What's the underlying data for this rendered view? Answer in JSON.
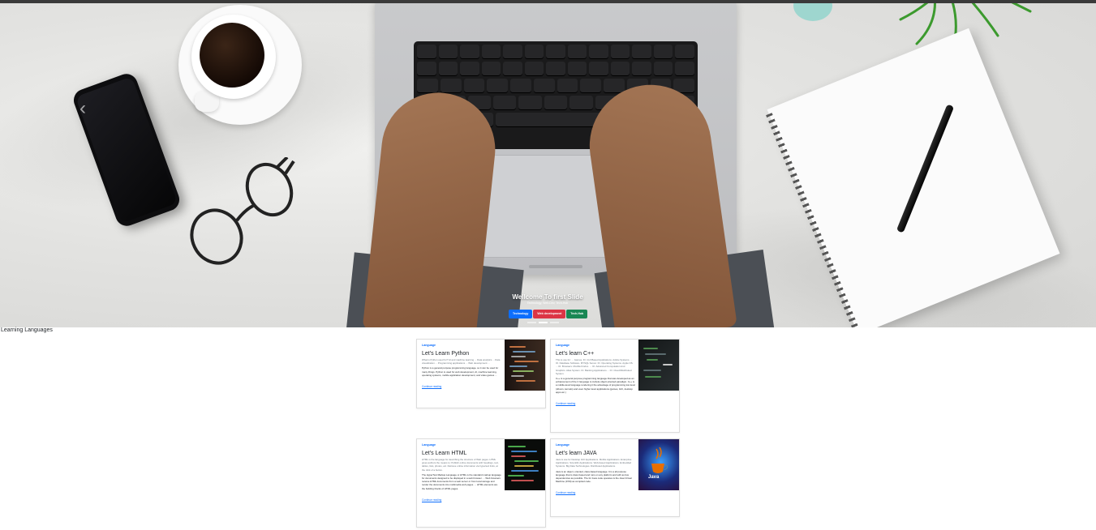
{
  "hero": {
    "title": "Wellcome To first Slide",
    "subtitle": "Technology, Web-Dev, Tech-Hub",
    "prev_glyph": "‹",
    "badges": [
      {
        "label": "Technology",
        "color": "#0d6efd"
      },
      {
        "label": "Web development",
        "color": "#dc3545"
      },
      {
        "label": "Tech-Hub",
        "color": "#198754"
      }
    ],
    "indicator_count": 3,
    "active_indicator": 1
  },
  "section": {
    "title": "Learning Languages"
  },
  "cards": [
    {
      "category": "Language",
      "title": "Let's Learn Python",
      "excerpt": "What is Python used for? AI and machine learning ... Data analytics ... Data visualization ... Programming applications ... Web development ...",
      "body": "Python is a general purpose programming language, so it can be used for many things. Python is used for web development, AI, machine learning, operating systems, mobile application development, and video games ...",
      "link": "Continue reading",
      "thumb": "python-code-image"
    },
    {
      "category": "Language",
      "title": "Let's learn C++",
      "excerpt": "This is use for: ... Games, IO. GUI Based Applications. Adobe Systems. ... IO. Database Software. MYSQL Server. IO. Operating Systems. Apple OS. ... IO. Browsers. Mozilla Firefox. ... IO. Advanced Computation And Graphics. Alias System. IO. Banking Applications ... IO. Cloud/Distributed System.",
      "body": "C++ is a general purpose programming language that was developed as an enhancement of the C language to include object-oriented paradigm. C++ is a middle-level language rendering it the advantage of programming low level (drivers, kernels) and even higher level applications (games, GUI, desktop apps etc.)",
      "link": "Continue reading",
      "thumb": "cpp-code-image"
    },
    {
      "category": "Language",
      "title": "Let's Learn HTML",
      "excerpt": "HTML is the language for describing the structure of Web pages. HTML gives authors the means to: Publish online documents with headings, text, tables, lists, photos, etc. Retrieve online information via hypertext links, at the click of a button.",
      "body": "The HyperText Markup Language or HTML is the standard markup language for documents designed to be displayed in a web browser. ... Web browsers receive HTML documents from a web server or from local storage and render the documents into multimedia web pages. ... HTML elements are the building blocks of HTML pages.",
      "link": "Continue reading",
      "thumb": "html-code-image"
    },
    {
      "category": "Language",
      "title": "Let's learn JAVA",
      "excerpt": "Java is use for Desktop GUI Applications. Mobile Applications. Enterprise Applications. Scientific Applications. Web-based Applications. Embedded Systems. Big Data Technologies. Distributed Applications.",
      "body": "Java is an object- oriented, class-based language. It is a all purpose language that is class based and runs on any platform and with as few dependencies as possible. The for Java code operates is the Java Virtual Machine (JVM) as compiled code.",
      "link": "Continue reading",
      "thumb": "java-logo-image",
      "thumb_text": "Java"
    }
  ]
}
